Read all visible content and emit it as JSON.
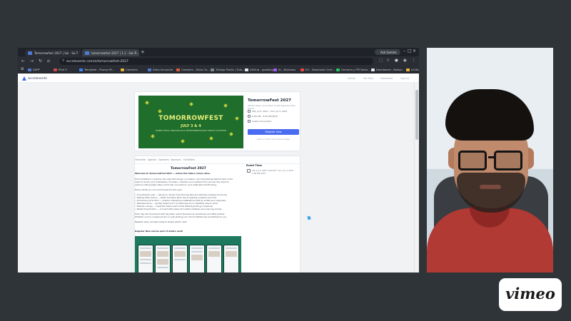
{
  "browser": {
    "tabs": [
      {
        "label": "Tomorrowfest 2027 | Sal - Sa..."
      },
      {
        "label": "tomorrowfest 2027 | 1.1 - Sat 3..."
      }
    ],
    "new_tab": "+",
    "ask_gemini": "Ask Gemini",
    "window_controls": {
      "minimize": "–",
      "maximize": "□",
      "close": "×"
    },
    "nav": {
      "back": "←",
      "forward": "→",
      "reload": "↻",
      "home": "⌂"
    },
    "address": "accelevents.com/e/tomorrowfest-2027",
    "bookmarks": [
      {
        "label": "SAPP",
        "color": "#4f7ad6"
      },
      {
        "label": "Pilot 5",
        "color": "#d24a43"
      },
      {
        "label": "Template - Promo Mi...",
        "color": "#3c82f6"
      },
      {
        "label": "Contacts",
        "color": "#e7b33c"
      },
      {
        "label": "Zoho Accounts",
        "color": "#4f7ad6"
      },
      {
        "label": "Contacts - Zoho Co...",
        "color": "#e05d3a"
      },
      {
        "label": "Tidings Public / Sub...",
        "color": "#7b8794"
      },
      {
        "label": "GitHub - goodsky...",
        "color": "#e6e6e6"
      },
      {
        "label": "AI - Business",
        "color": "#a855f7"
      },
      {
        "label": "K3 - Download Cent...",
        "color": "#ef4444"
      },
      {
        "label": "Humans.y PM Notio...",
        "color": "#22c55e"
      },
      {
        "label": "Dashboard - Notion",
        "color": "#e6e6e6"
      },
      {
        "label": "All Bookmarks",
        "color": "#e7b33c"
      }
    ]
  },
  "site": {
    "logo": "accelevents",
    "header_links": [
      "Events",
      "Get Help",
      "Dashboard",
      "Log out"
    ]
  },
  "event": {
    "banner_title": "TOMORROWFEST",
    "banner_date": "JULY 3 & 4",
    "banner_tagline": "WHERE IDEAS, INNOVATION & ENTREPRENEURSHIP THRIVE TOGETHER",
    "title": "TomorrowFest 2027",
    "subtitle": "Where ideas, innovation & entrepreneurship thrive",
    "date": "Sat, Jul 3, 2027 - Sun, Jul 4, 2027",
    "time": "9:00 AM - 5:00 PM (EST)",
    "location": "Austin Convention",
    "register_label": "Register Now",
    "small_note": "Have a code? Click here to apply"
  },
  "content": {
    "tabs": [
      "Overview",
      "Agenda",
      "Speakers",
      "Sponsors",
      "Exhibitors"
    ],
    "heading": "TomorrowFest 2027",
    "paragraphs": [
      "Welcome to TomorrowFest 2027 — where the future comes alive.",
      "TomorrowFest is a premier two-day technology, innovation, and storytelling festival held in the",
      "heart of Austin. Join trailblazers, founders, investors and creators from all over the world to",
      "explore cutting-edge ideas, build real connections, and celebrate bold thinking.",
      "Here's what you can look forward to this year:",
      "• AI & Robotics Lab — hands-on demos from the top labs and startups shaping tomorrow",
      "• Startup Pitch Arena — watch founders pitch live to leading investors and VCs",
      "• Immersive Art & Tech — explore interactive installations built by artists and engineers",
      "• Wellness Zone — guided sessions for mindfulness and a healthier way to work",
      "• Startup Lounge — meet the teams behind the fastest-growing companies",
      "• Networking Events — connect with peers at curated meetups and evening socials",
      "Each day will be packed with keynotes, panel discussions, workshops and after-parties.",
      "Whether you're a seasoned pro or just starting out, TomorrowFest has something for you.",
      "Register early and get ready to shape what's next."
    ],
    "bold_line": "Register Now and be part of what's next!",
    "sidebar_title": "Event Time",
    "sidebar_lines": [
      "Sat, Jul 3, 2027 9:00 AM - Sun, Jul 4, 2027",
      "5:00 PM (EST)"
    ]
  },
  "webcam": {
    "label": "presenter-webcam"
  },
  "branding": {
    "vimeo": "vimeo"
  },
  "colors": {
    "banner_green": "#1f6e2c",
    "banner_text": "#e8ef7a",
    "accent_blue": "#4a6cf0",
    "background": "#2f3439"
  }
}
